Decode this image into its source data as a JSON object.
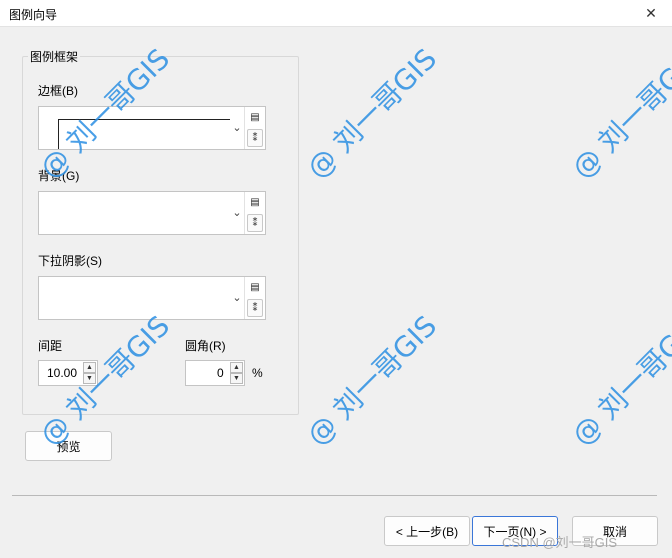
{
  "window": {
    "title": "图例向导",
    "close_glyph": "✕"
  },
  "legend_frame": {
    "group_title": "图例框架",
    "border_label": "边框(B)",
    "background_label": "背景(G)",
    "shadow_label": "下拉阴影(S)",
    "gap_label": "间距",
    "gap_value": "10.00",
    "corner_label": "圆角(R)",
    "corner_value": "0",
    "corner_unit": "%"
  },
  "buttons": {
    "preview": "预览",
    "back": "< 上一步(B)",
    "next": "下一页(N) >",
    "cancel": "取消"
  },
  "watermark": {
    "text": "@ 刘一哥GIS",
    "csdn": "CSDN @刘一哥GIS"
  },
  "icons": {
    "symbol_picker": "symbol-properties-icon",
    "symbol_edit": "symbol-edit-icon",
    "dropdown": "chevron-down-icon"
  },
  "colors": {
    "watermark": "#2b8fe3",
    "dialog_bg": "#f0f0f0",
    "primary_border": "#3a76d8"
  }
}
